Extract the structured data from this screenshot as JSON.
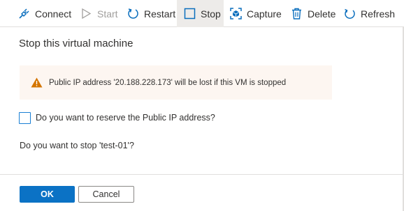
{
  "toolbar": {
    "connect": "Connect",
    "start": "Start",
    "restart": "Restart",
    "stop": "Stop",
    "capture": "Capture",
    "delete": "Delete",
    "refresh": "Refresh"
  },
  "dialog": {
    "title": "Stop this virtual machine",
    "warning": "Public IP address '20.188.228.173' will be lost if this VM is stopped",
    "reserve_ip_label": "Do you want to reserve the Public IP address?",
    "reserve_ip_checked": false,
    "question": "Do you want to stop 'test-01'?",
    "ok_label": "OK",
    "cancel_label": "Cancel"
  },
  "colors": {
    "accent": "#0b72c5",
    "warning": "#d47500",
    "warning_bg": "#fdf6f1"
  },
  "icons": {
    "connect": "plug-icon",
    "start": "play-icon",
    "restart": "restart-icon",
    "stop": "stop-icon",
    "capture": "capture-icon",
    "delete": "trash-icon",
    "refresh": "refresh-icon",
    "warning": "warning-triangle-icon"
  }
}
